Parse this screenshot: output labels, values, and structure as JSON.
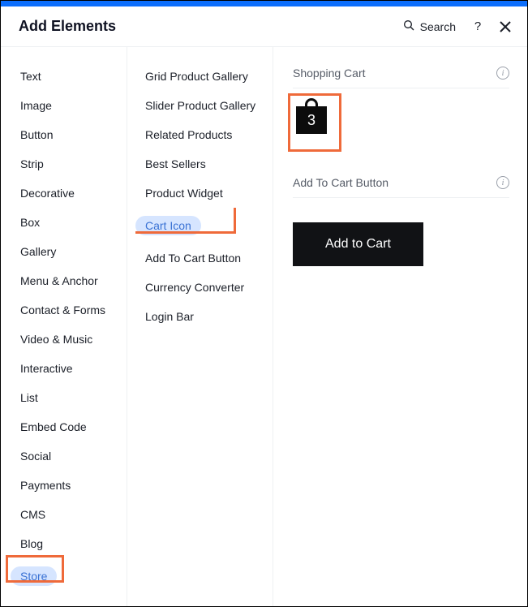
{
  "header": {
    "title": "Add Elements",
    "search_label": "Search"
  },
  "categories": [
    {
      "id": "text",
      "label": "Text"
    },
    {
      "id": "image",
      "label": "Image"
    },
    {
      "id": "button",
      "label": "Button"
    },
    {
      "id": "strip",
      "label": "Strip"
    },
    {
      "id": "decorative",
      "label": "Decorative"
    },
    {
      "id": "box",
      "label": "Box"
    },
    {
      "id": "gallery",
      "label": "Gallery"
    },
    {
      "id": "menu-anchor",
      "label": "Menu & Anchor"
    },
    {
      "id": "contact-forms",
      "label": "Contact & Forms"
    },
    {
      "id": "video-music",
      "label": "Video & Music"
    },
    {
      "id": "interactive",
      "label": "Interactive"
    },
    {
      "id": "list",
      "label": "List"
    },
    {
      "id": "embed-code",
      "label": "Embed Code"
    },
    {
      "id": "social",
      "label": "Social"
    },
    {
      "id": "payments",
      "label": "Payments"
    },
    {
      "id": "cms",
      "label": "CMS"
    },
    {
      "id": "blog",
      "label": "Blog"
    },
    {
      "id": "store",
      "label": "Store",
      "selected": true
    }
  ],
  "subcategories": [
    {
      "id": "grid-product-gallery",
      "label": "Grid Product Gallery"
    },
    {
      "id": "slider-product-gallery",
      "label": "Slider Product Gallery"
    },
    {
      "id": "related-products",
      "label": "Related Products"
    },
    {
      "id": "best-sellers",
      "label": "Best Sellers"
    },
    {
      "id": "product-widget",
      "label": "Product Widget"
    },
    {
      "id": "cart-icon",
      "label": "Cart Icon",
      "selected": true
    },
    {
      "id": "add-to-cart-button",
      "label": "Add To Cart Button"
    },
    {
      "id": "currency-converter",
      "label": "Currency Converter"
    },
    {
      "id": "login-bar",
      "label": "Login Bar"
    }
  ],
  "preview": {
    "section1_title": "Shopping Cart",
    "cart_count": "3",
    "section2_title": "Add To Cart Button",
    "button_label": "Add to Cart"
  }
}
